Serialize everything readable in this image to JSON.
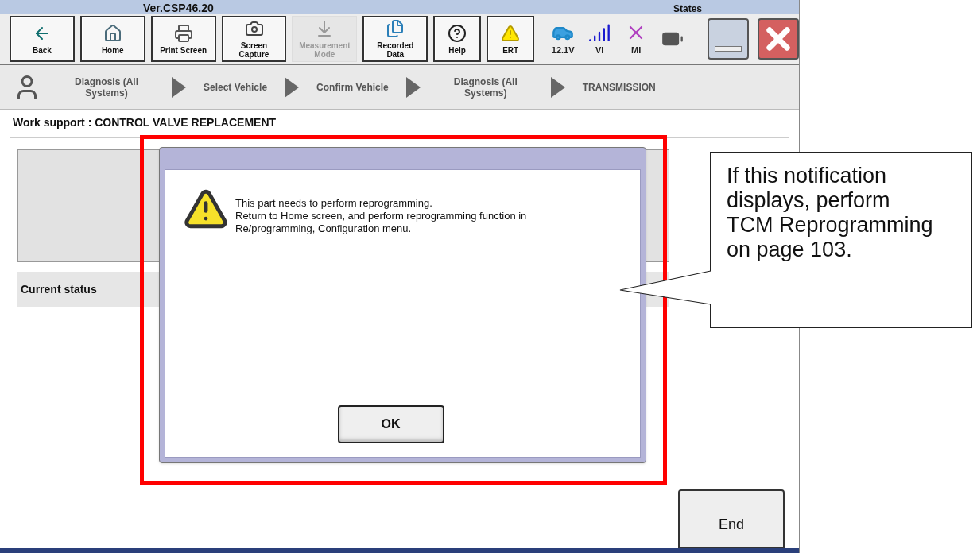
{
  "app": {
    "version": "Ver.CSP46.20",
    "states_label": "States"
  },
  "toolbar": [
    {
      "label": "Back",
      "kind": "back",
      "disabled": false
    },
    {
      "label": "Home",
      "kind": "home",
      "disabled": false
    },
    {
      "label": "Print Screen",
      "kind": "print",
      "disabled": false
    },
    {
      "label": "Screen Capture",
      "kind": "camera",
      "disabled": false
    },
    {
      "label": "Measurement Mode",
      "kind": "measure",
      "disabled": true
    },
    {
      "label": "Recorded Data",
      "kind": "files",
      "disabled": false
    },
    {
      "label": "Help",
      "kind": "help",
      "disabled": false
    },
    {
      "label": "ERT",
      "kind": "warning",
      "disabled": false
    }
  ],
  "status_indicators": [
    {
      "label": "12.1V",
      "kind": "car"
    },
    {
      "label": "VI",
      "kind": "signal"
    },
    {
      "label": "MI",
      "kind": "cross"
    },
    {
      "kind": "battery"
    }
  ],
  "breadcrumb": [
    "Diagnosis (All Systems)",
    "Select Vehicle",
    "Confirm Vehicle",
    "Diagnosis (All Systems)",
    "TRANSMISSION"
  ],
  "page_title": "Work support : CONTROL VALVE REPLACEMENT",
  "current_status_label": "Current status",
  "dialog": {
    "message_lines": [
      "This part needs to perform reprogramming.",
      "Return to Home screen, and perform reprogramming function in",
      "Re/programming, Configuration menu."
    ],
    "ok": "OK"
  },
  "end_button": "End",
  "callout": {
    "text": "If this notification displays, perform TCM Reprogramming on page 103."
  }
}
